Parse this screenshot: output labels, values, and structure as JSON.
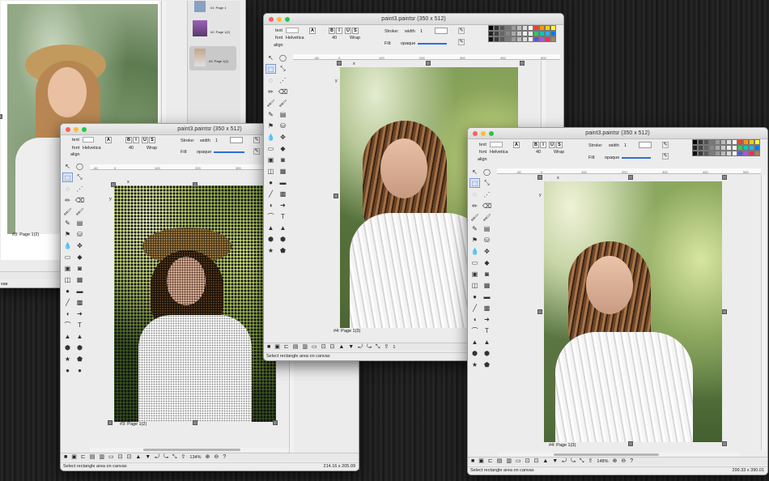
{
  "windows": {
    "back_left": {
      "page_label": "#3: Page 1(2)",
      "thumbs": [
        {
          "label": "#1: Page 1"
        },
        {
          "label": "#2: Page 1(2)"
        },
        {
          "label": "#3: Page 1(2)"
        }
      ],
      "status_text": "vas"
    },
    "halftone": {
      "title": "paint3.paintsr (350 x 512)",
      "text_label": "text",
      "font_label": "font",
      "font_name": "Helvetica",
      "font_size": "40",
      "wrap_label": "Wrap",
      "align_label": "align",
      "stroke_label": "Stroke:",
      "width_label": "width",
      "width_value": "1",
      "fill_label": "Fill:",
      "fill_value": "opaque",
      "ruler_ticks": [
        "-60",
        "0",
        "100",
        "200",
        "300",
        "400"
      ],
      "axis_x": "x",
      "axis_y": "y",
      "page_label": "#3: Page 1(2)",
      "zoom": "134%",
      "status_text": "Select rectangle area on canvas",
      "coords": "214.16 x 205.09"
    },
    "middle": {
      "title": "paint3.paintsr (350 x 512)",
      "text_label": "text",
      "font_label": "font",
      "font_name": "Helvetica",
      "font_size": "40",
      "wrap_label": "Wrap",
      "align_label": "align",
      "stroke_label": "Stroke:",
      "width_label": "width",
      "width_value": "1",
      "fill_label": "Fill:",
      "fill_value": "opaque",
      "ruler_ticks": [
        "-60",
        "0",
        "100",
        "200",
        "300",
        "400",
        "500"
      ],
      "axis_x": "x",
      "axis_y": "y",
      "page_label": "#4: Page 1(3)",
      "zoom": "1",
      "status_text": "Select rectangle area on canvas"
    },
    "right": {
      "title": "paint3.paintsr (350 x 512)",
      "text_label": "text",
      "font_label": "font",
      "font_name": "Helvetica",
      "font_size": "40",
      "wrap_label": "Wrap",
      "align_label": "align",
      "stroke_label": "Stroke:",
      "width_label": "width",
      "width_value": "1",
      "fill_label": "Fill:",
      "fill_value": "opaque",
      "ruler_ticks": [
        "-60",
        "0",
        "100",
        "200",
        "300",
        "400",
        "500"
      ],
      "axis_x": "x",
      "axis_y": "y",
      "page_label": "#4: Page 1(3)",
      "zoom": "148%",
      "status_text": "Select rectangle area on canvas",
      "coords": "299.33 x 390.01"
    }
  },
  "toolbar_glyphs": {
    "font_a": "A",
    "bold": "B",
    "italic": "I",
    "underline": "U",
    "strike": "S",
    "text_tool": "T"
  },
  "colors": {
    "window_bg": "#ececec",
    "selection": "#7a9ad8",
    "accent_blue": "#2a6fdb",
    "palette": [
      "#000000",
      "#333333",
      "#555555",
      "#777777",
      "#999999",
      "#bbbbbb",
      "#dddddd",
      "#ffffff",
      "#ff3b30",
      "#ff9500",
      "#ffcc00",
      "#ffff33",
      "#222222",
      "#444444",
      "#666666",
      "#888888",
      "#aaaaaa",
      "#cccccc",
      "#eeeeee",
      "#f5f5f5",
      "#34c759",
      "#00c7be",
      "#32ade6",
      "#007aff",
      "#111111",
      "#3a3a3a",
      "#5a5a5a",
      "#7a7a7a",
      "#9a9a9a",
      "#bababa",
      "#dadada",
      "#fafafa",
      "#5856d6",
      "#af52de",
      "#ff2d55",
      "#a2845e"
    ]
  }
}
